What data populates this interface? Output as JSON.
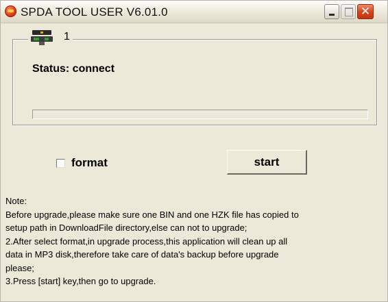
{
  "window": {
    "title": "SPDA TOOL USER V6.01.0",
    "controls": [
      "minimize",
      "maximize",
      "close"
    ],
    "close_glyph": "✕"
  },
  "device_group": {
    "icon": "device-board-icon",
    "number": "1",
    "status": "Status: connect",
    "progress": 0
  },
  "options": {
    "format_label": "format",
    "format_checked": false,
    "start_label": "start"
  },
  "note": {
    "lines": [
      "Note:",
      "Before upgrade,please make sure one BIN and one HZK file has copied to",
      "setup path in DownloadFile directory,else can not to upgrade;",
      "2.After select format,in upgrade process,this application will clean up all",
      "data in MP3 disk,therefore take care of data's backup before upgrade",
      "please;",
      "3.Press [start] key,then go to upgrade."
    ]
  },
  "colors": {
    "window_bg": "#ece9d8",
    "close_button": "#d64720",
    "app_icon": "#d42a0a"
  }
}
